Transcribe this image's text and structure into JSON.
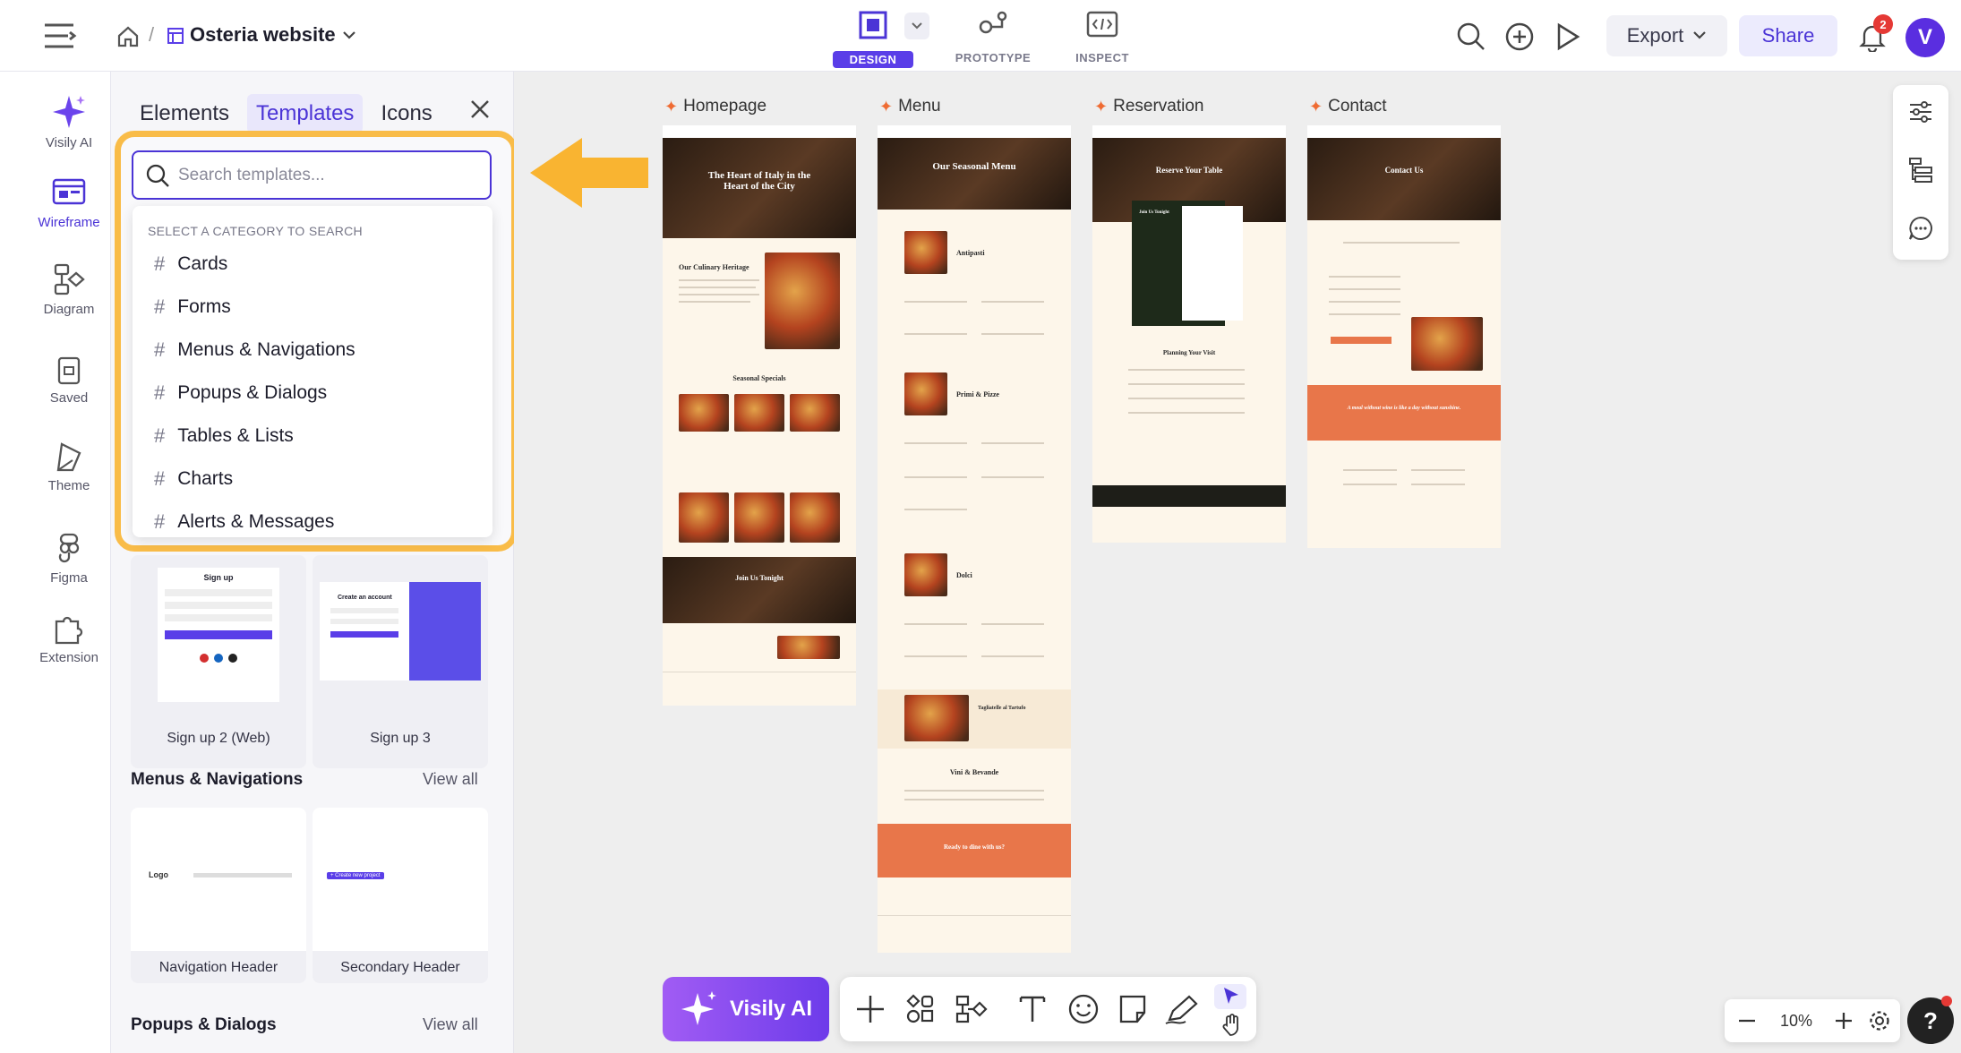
{
  "header": {
    "breadcrumb_sep": "/",
    "project_name": "Osteria website",
    "modes": [
      {
        "label": "DESIGN",
        "active": true
      },
      {
        "label": "PROTOTYPE",
        "active": false
      },
      {
        "label": "INSPECT",
        "active": false
      }
    ],
    "export_label": "Export",
    "share_label": "Share",
    "notification_count": "2",
    "avatar_letter": "V"
  },
  "rail": {
    "items": [
      {
        "label": "Visily AI",
        "icon": "sparkle-icon"
      },
      {
        "label": "Wireframe",
        "icon": "wireframe-icon"
      },
      {
        "label": "Diagram",
        "icon": "diagram-icon"
      },
      {
        "label": "Saved",
        "icon": "saved-icon"
      },
      {
        "label": "Theme",
        "icon": "theme-icon"
      },
      {
        "label": "Figma",
        "icon": "figma-icon"
      },
      {
        "label": "Extension",
        "icon": "puzzle-icon"
      }
    ]
  },
  "panel": {
    "tabs": [
      "Elements",
      "Templates",
      "Icons"
    ],
    "active_tab": "Templates",
    "search_placeholder": "Search templates...",
    "dropdown_title": "SELECT A CATEGORY TO SEARCH",
    "categories": [
      "Cards",
      "Forms",
      "Menus & Navigations",
      "Popups & Dialogs",
      "Tables & Lists",
      "Charts",
      "Alerts & Messages"
    ],
    "forms_cards": [
      "Sign up 2 (Web)",
      "Sign up 3"
    ],
    "menus_title": "Menus & Navigations",
    "menus_cards": [
      "Navigation Header",
      "Secondary Header"
    ],
    "popups_title": "Popups & Dialogs",
    "view_all": "View all",
    "thumb_texts": {
      "signup_title": "Sign up",
      "create_account": "Create an account",
      "logo": "Logo",
      "create_project": "+ Create new project"
    }
  },
  "canvas": {
    "frames": [
      "Homepage",
      "Menu",
      "Reservation",
      "Contact"
    ],
    "homepage_hero": "The Heart of Italy in the Heart of the City",
    "homepage_section1": "Our Culinary Heritage",
    "homepage_section2": "Seasonal Specials",
    "homepage_section3": "Join Us Tonight",
    "menu_hero": "Our Seasonal Menu",
    "menu_sections": [
      "Antipasti",
      "Primi & Pizze",
      "Dolci",
      "Tagliatelle al Tartufo",
      "Vini & Bevande"
    ],
    "menu_cta": "Ready to dine with us?",
    "reservation_hero": "Reserve Your Table",
    "reservation_side": "Join Us Tonight",
    "reservation_section": "Planning Your Visit",
    "contact_hero": "Contact Us",
    "contact_quote": "A meal without wine is like a day without sunshine."
  },
  "bottom": {
    "visily_ai_label": "Visily AI",
    "zoom_level": "10%"
  },
  "colors": {
    "accent": "#5a3ee8",
    "highlight": "#f9bc48",
    "brand_orange": "#ef6b32"
  }
}
